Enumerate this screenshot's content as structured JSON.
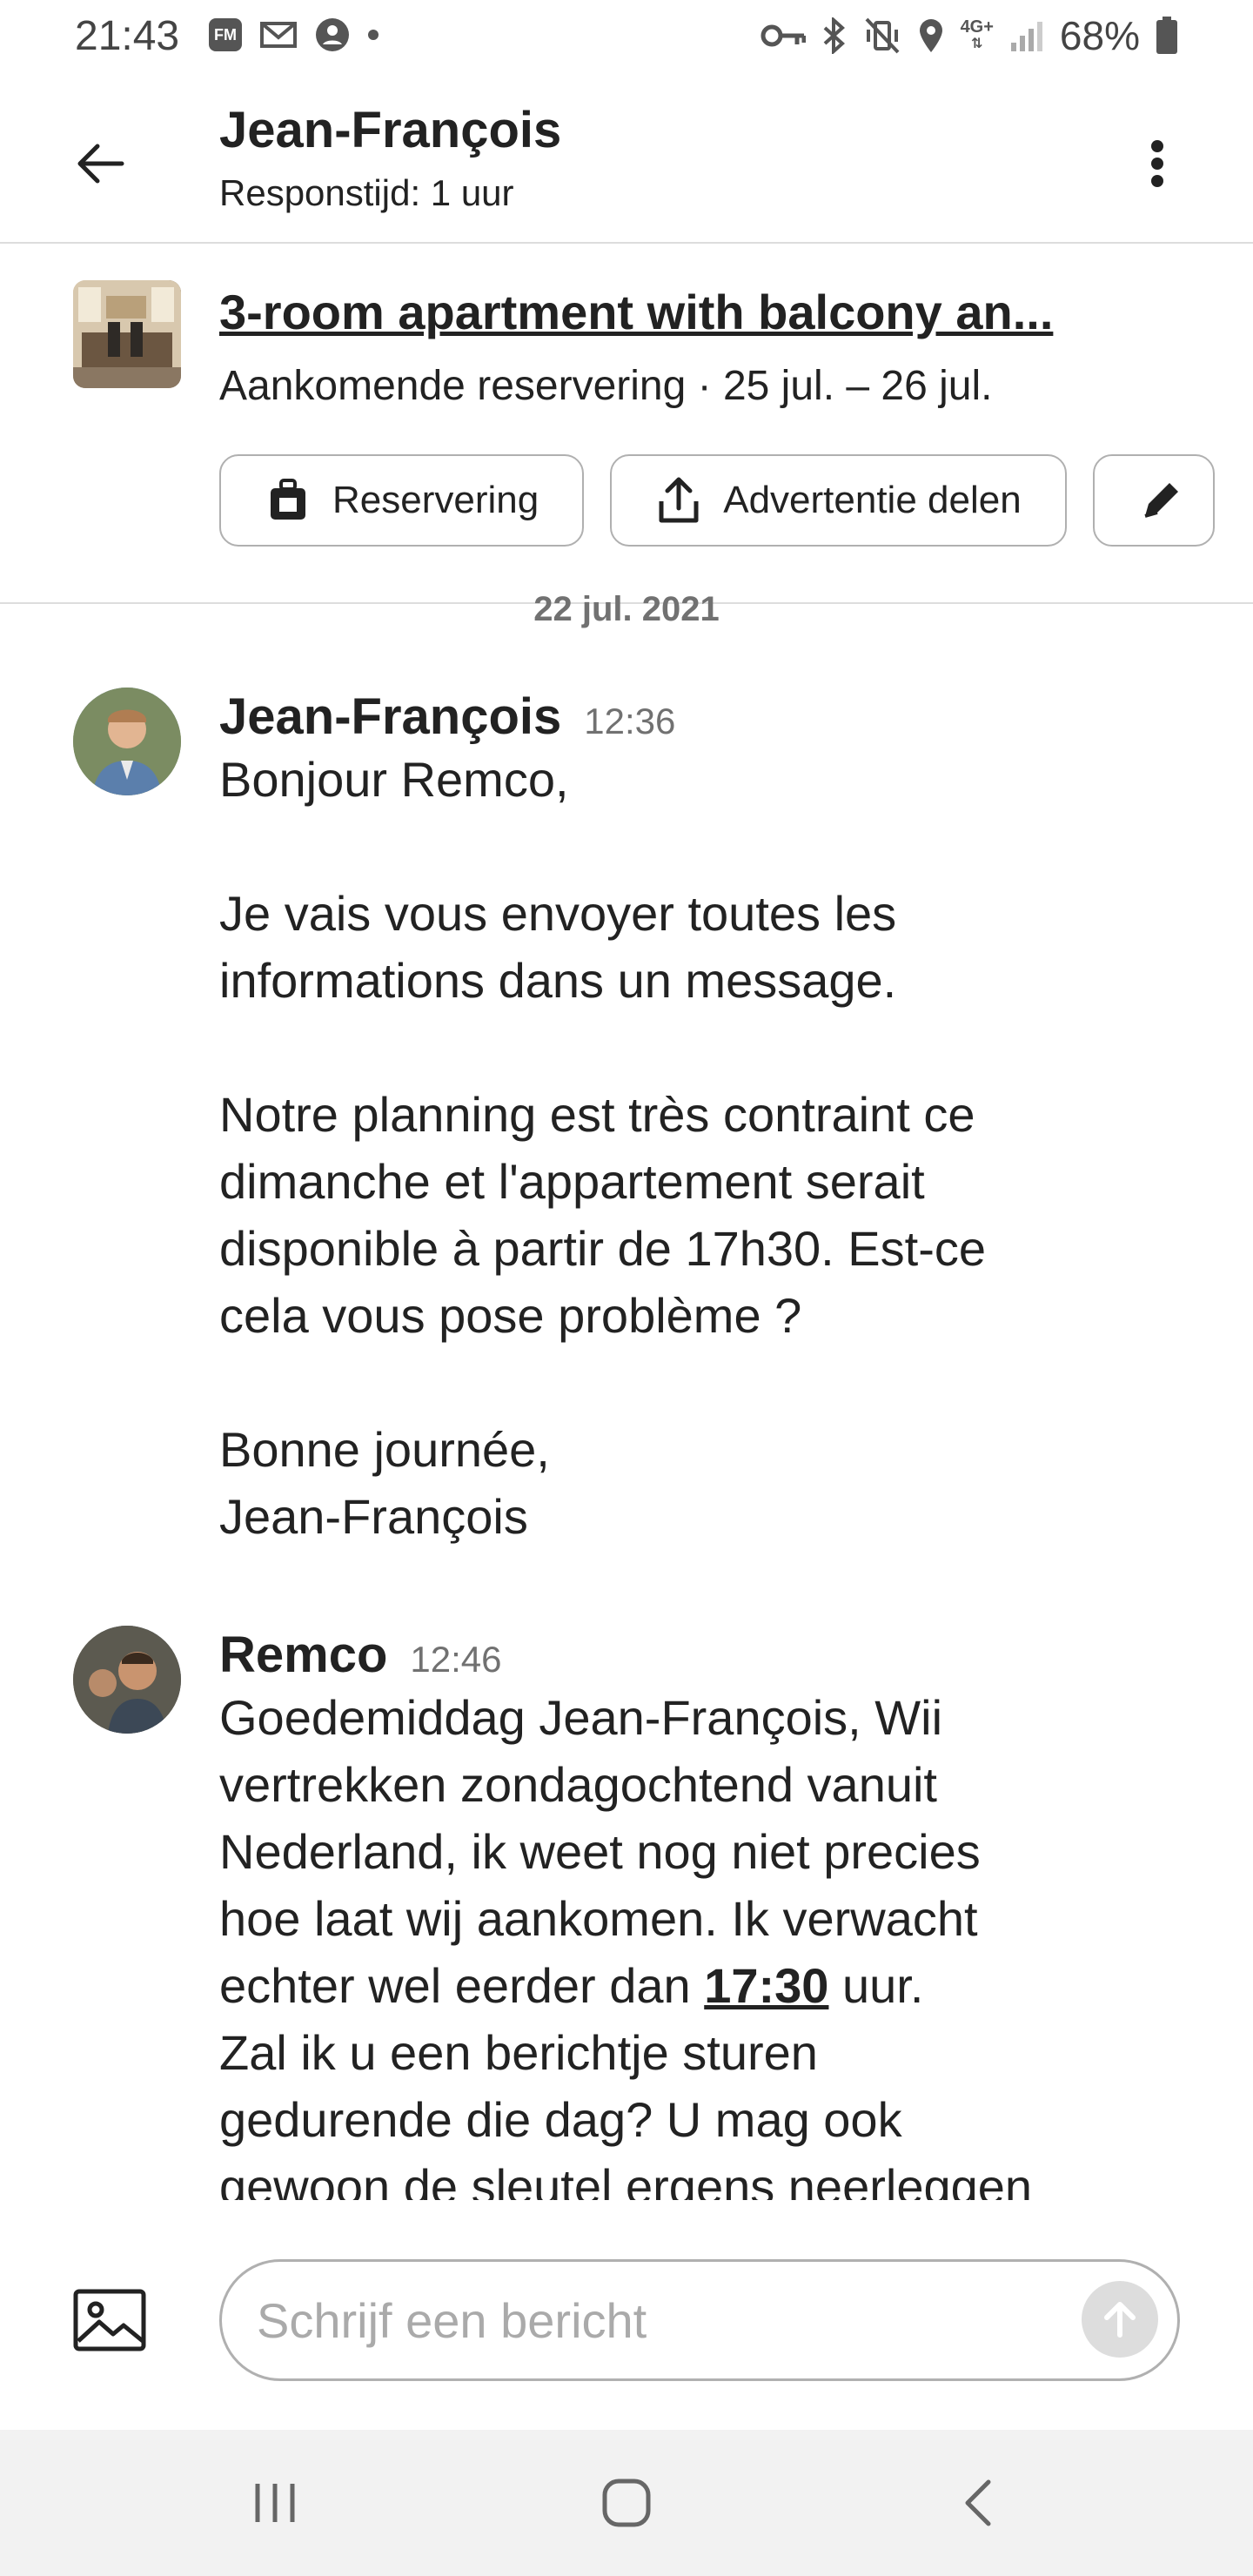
{
  "status_bar": {
    "time": "21:43",
    "battery": "68%",
    "left_icons": [
      "fm-icon",
      "gmail-icon",
      "account-icon",
      "dot-icon"
    ],
    "right_icons": [
      "vpn-key-icon",
      "bluetooth-icon",
      "vibrate-icon",
      "location-icon",
      "network-4g-icon",
      "signal-icon",
      "battery-icon"
    ]
  },
  "header": {
    "host_name": "Jean-François",
    "response_time": "Responstijd: 1 uur"
  },
  "listing": {
    "title": "3-room apartment with balcony an...",
    "subtitle": "Aankomende reservering · 25 jul. – 26 jul.",
    "chips": [
      {
        "label": "Reservering",
        "icon": "luggage-icon"
      },
      {
        "label": "Advertentie delen",
        "icon": "share-icon"
      },
      {
        "label": "",
        "icon": "pencil-icon"
      }
    ]
  },
  "date_separator": "22 jul. 2021",
  "messages": [
    {
      "sender": "Jean-François",
      "time": "12:36",
      "text": "Bonjour Remco,\n\nJe vais vous envoyer toutes les\ninformations dans un message.\n\nNotre planning est très contraint ce\ndimanche et l'appartement serait\ndisponible à partir de 17h30. Est-ce\ncela vous pose problème ?\n\nBonne journée,\nJean-François"
    },
    {
      "sender": "Remco",
      "time": "12:46",
      "text_before": "Goedemiddag Jean-François, Wii\nvertrekken zondagochtend vanuit\nNederland, ik weet nog niet precies\nhoe laat wij aankomen. Ik verwacht\nechter wel eerder dan ",
      "text_link": "17:30",
      "text_after": " uur.\nZal ik u een berichtje sturen\ngedurende die dag? U mag ook\ngewoon de sleutel ergens neerleggen"
    }
  ],
  "composer": {
    "placeholder": "Schrijf een bericht"
  },
  "colors": {
    "text": "#222222",
    "muted": "#717171",
    "border": "#b0b0b0",
    "divider": "#dddddd",
    "navbar_bg": "#f2f2f2"
  }
}
